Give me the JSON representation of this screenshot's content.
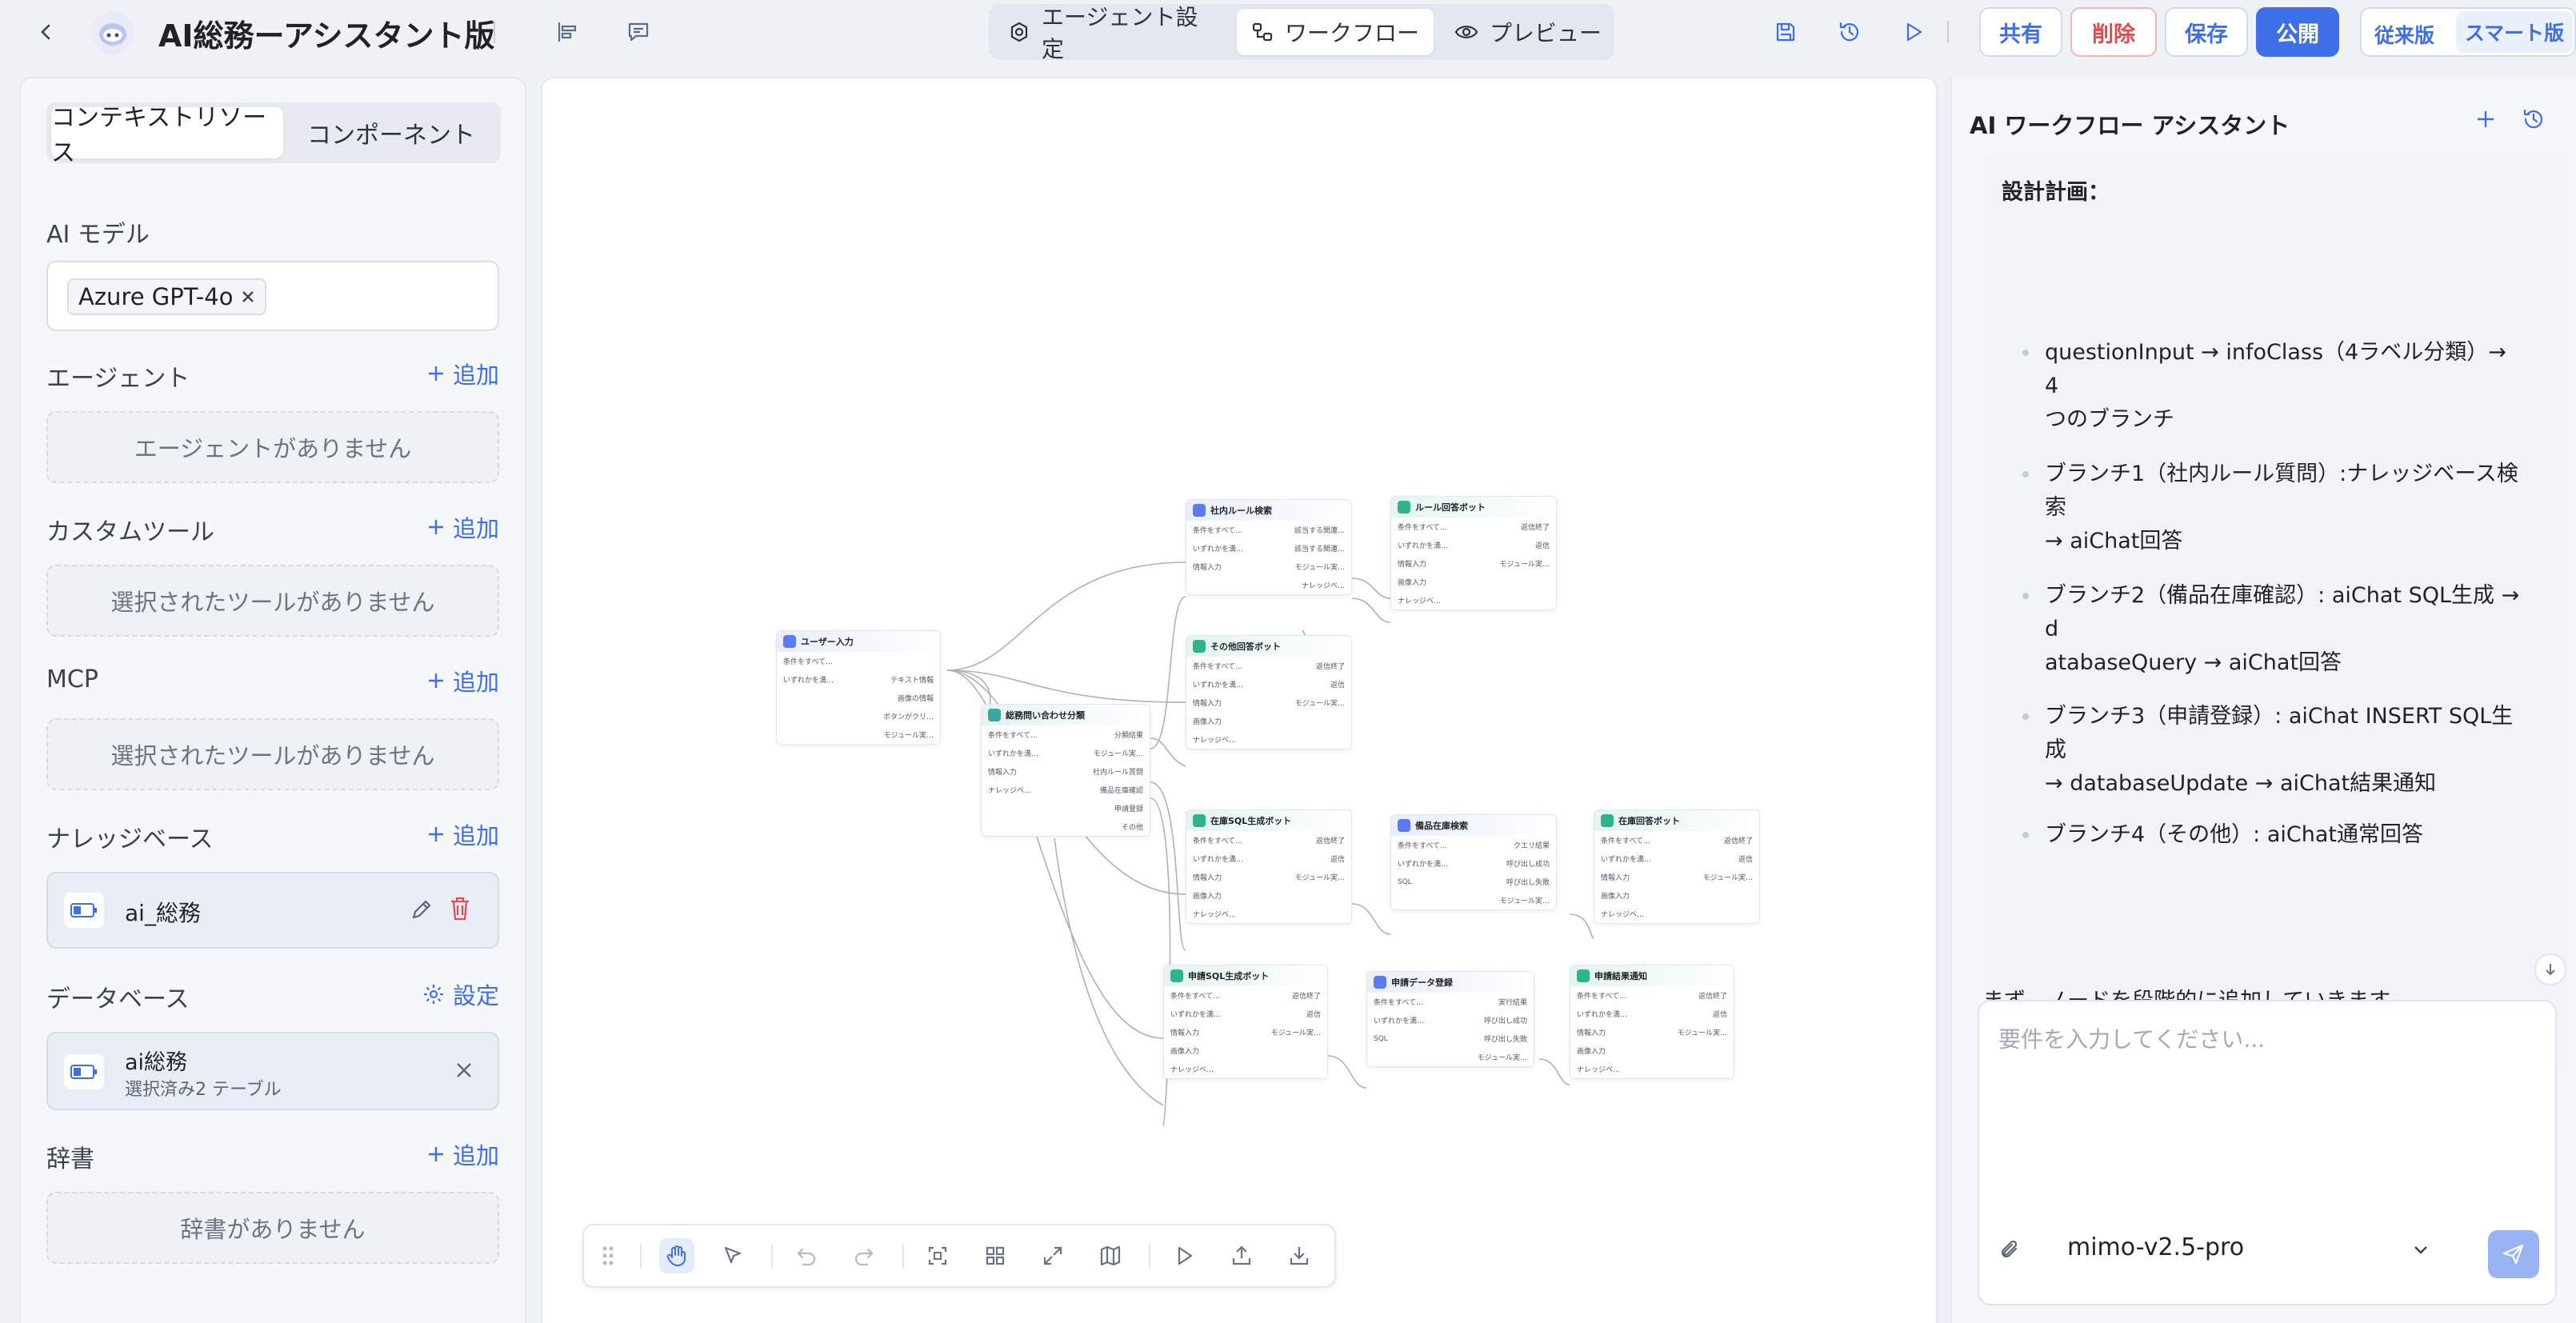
{
  "header": {
    "title": "AI総務ーアシスタント版",
    "tabs": [
      {
        "label": "エージェント設定",
        "icon": "settings-icon"
      },
      {
        "label": "ワークフロー",
        "icon": "workflow-icon"
      },
      {
        "label": "プレビュー",
        "icon": "eye-icon"
      }
    ],
    "buttons": {
      "share": "共有",
      "delete": "削除",
      "save": "保存",
      "publish": "公開"
    },
    "versions": [
      "従来版",
      "スマート版"
    ]
  },
  "left": {
    "tabs": [
      "コンテキストリソース",
      "コンポーネント"
    ],
    "ai_model_label": "AI モデル",
    "ai_model_value": "Azure GPT-4o",
    "add_label": "追加",
    "agent": {
      "title": "エージェント",
      "empty": "エージェントがありません"
    },
    "custom_tool": {
      "title": "カスタムツール",
      "empty": "選択されたツールがありません"
    },
    "mcp": {
      "title": "MCP",
      "empty": "選択されたツールがありません"
    },
    "knowledge": {
      "title": "ナレッジベース",
      "item": "ai_総務"
    },
    "database": {
      "title": "データベース",
      "action": "設定",
      "item_name": "ai総務",
      "item_sub": "選択済み2 テーブル"
    },
    "dictionary": {
      "title": "辞書",
      "empty": "辞書がありません"
    }
  },
  "canvas": {
    "nodes": [
      {
        "title": "ユーザー入力",
        "color": "#5b7cf0",
        "rows": [
          [
            "条件をすべて…",
            ""
          ],
          [
            "いずれかを満…",
            "テキスト情報"
          ],
          [
            "",
            "画像の情報"
          ],
          [
            "",
            "ボタンがクリ…"
          ],
          [
            "",
            "モジュール実…"
          ]
        ]
      },
      {
        "title": "総務問い合わせ分類",
        "color": "#3aa6a0",
        "rows": [
          [
            "条件をすべて…",
            "分類結果"
          ],
          [
            "いずれかを満…",
            "モジュール実…"
          ],
          [
            "情報入力",
            "社内ルール質問"
          ],
          [
            "ナレッジベ…",
            "備品在庫確認"
          ],
          [
            "",
            "申請登録"
          ],
          [
            "",
            "その他"
          ]
        ]
      },
      {
        "title": "社内ルール検索",
        "color": "#5b7cf0",
        "rows": [
          [
            "条件をすべて…",
            "該当する関連…"
          ],
          [
            "いずれかを満…",
            "該当する関連…"
          ],
          [
            "情報入力",
            "モジュール実…"
          ],
          [
            "",
            "ナレッジベ…"
          ]
        ]
      },
      {
        "title": "ルール回答ボット",
        "color": "#2fb38a",
        "rows": [
          [
            "条件をすべて…",
            "返信終了"
          ],
          [
            "いずれかを満…",
            "返信"
          ],
          [
            "情報入力",
            "モジュール実…"
          ],
          [
            "画像入力",
            ""
          ],
          [
            "ナレッジベ…",
            ""
          ]
        ]
      },
      {
        "title": "その他回答ボット",
        "color": "#2fb38a",
        "rows": [
          [
            "条件をすべて…",
            "返信終了"
          ],
          [
            "いずれかを満…",
            "返信"
          ],
          [
            "情報入力",
            "モジュール実…"
          ],
          [
            "画像入力",
            ""
          ],
          [
            "ナレッジベ…",
            ""
          ]
        ]
      },
      {
        "title": "在庫SQL生成ボット",
        "color": "#2fb38a",
        "rows": [
          [
            "条件をすべて…",
            "返信終了"
          ],
          [
            "いずれかを満…",
            "返信"
          ],
          [
            "情報入力",
            "モジュール実…"
          ],
          [
            "画像入力",
            ""
          ],
          [
            "ナレッジベ…",
            ""
          ]
        ]
      },
      {
        "title": "備品在庫検索",
        "color": "#5b7cf0",
        "rows": [
          [
            "条件をすべて…",
            "クエリ結果"
          ],
          [
            "いずれかを満…",
            "呼び出し成功"
          ],
          [
            "SQL",
            "呼び出し失敗"
          ],
          [
            "",
            "モジュール実…"
          ]
        ]
      },
      {
        "title": "在庫回答ボット",
        "color": "#2fb38a",
        "rows": [
          [
            "条件をすべて…",
            "返信終了"
          ],
          [
            "いずれかを満…",
            "返信"
          ],
          [
            "情報入力",
            "モジュール実…"
          ],
          [
            "画像入力",
            ""
          ],
          [
            "ナレッジベ…",
            ""
          ]
        ]
      },
      {
        "title": "申請SQL生成ボット",
        "color": "#2fb38a",
        "rows": [
          [
            "条件をすべて…",
            "返信終了"
          ],
          [
            "いずれかを満…",
            "返信"
          ],
          [
            "情報入力",
            "モジュール実…"
          ],
          [
            "画像入力",
            ""
          ],
          [
            "ナレッジベ…",
            ""
          ]
        ]
      },
      {
        "title": "申請データ登録",
        "color": "#5b7cf0",
        "rows": [
          [
            "条件をすべて…",
            "実行結果"
          ],
          [
            "いずれかを満…",
            "呼び出し成功"
          ],
          [
            "SQL",
            "呼び出し失敗"
          ],
          [
            "",
            "モジュール実…"
          ]
        ]
      },
      {
        "title": "申請結果通知",
        "color": "#2fb38a",
        "rows": [
          [
            "条件をすべて…",
            "返信終了"
          ],
          [
            "いずれかを満…",
            "返信"
          ],
          [
            "情報入力",
            "モジュール実…"
          ],
          [
            "画像入力",
            ""
          ],
          [
            "ナレッジベ…",
            ""
          ]
        ]
      }
    ]
  },
  "assistant": {
    "title": "AI ワークフロー アシスタント",
    "heading": "設計計画：",
    "items": [
      [
        "questionInput → infoClass（4ラベル分類）→ 4",
        "つのブランチ"
      ],
      [
        "ブランチ1（社内ルール質問）:ナレッジベース検索",
        "→ aiChat回答"
      ],
      [
        "ブランチ2（備品在庫確認）: aiChat SQL生成 → d",
        "atabaseQuery → aiChat回答"
      ],
      [
        "ブランチ3（申請登録）: aiChat INSERT SQL生成",
        "→ databaseUpdate → aiChat結果通知"
      ],
      [
        "ブランチ4（その他）: aiChat通常回答",
        ""
      ]
    ],
    "footer_text": "まず、ノードを段階的に追加していきます。",
    "input_placeholder": "要件を入力してください...",
    "model": "mimo-v2.5-pro"
  },
  "colors": {
    "accent": "#3e6ee8",
    "danger": "#e5484d"
  }
}
